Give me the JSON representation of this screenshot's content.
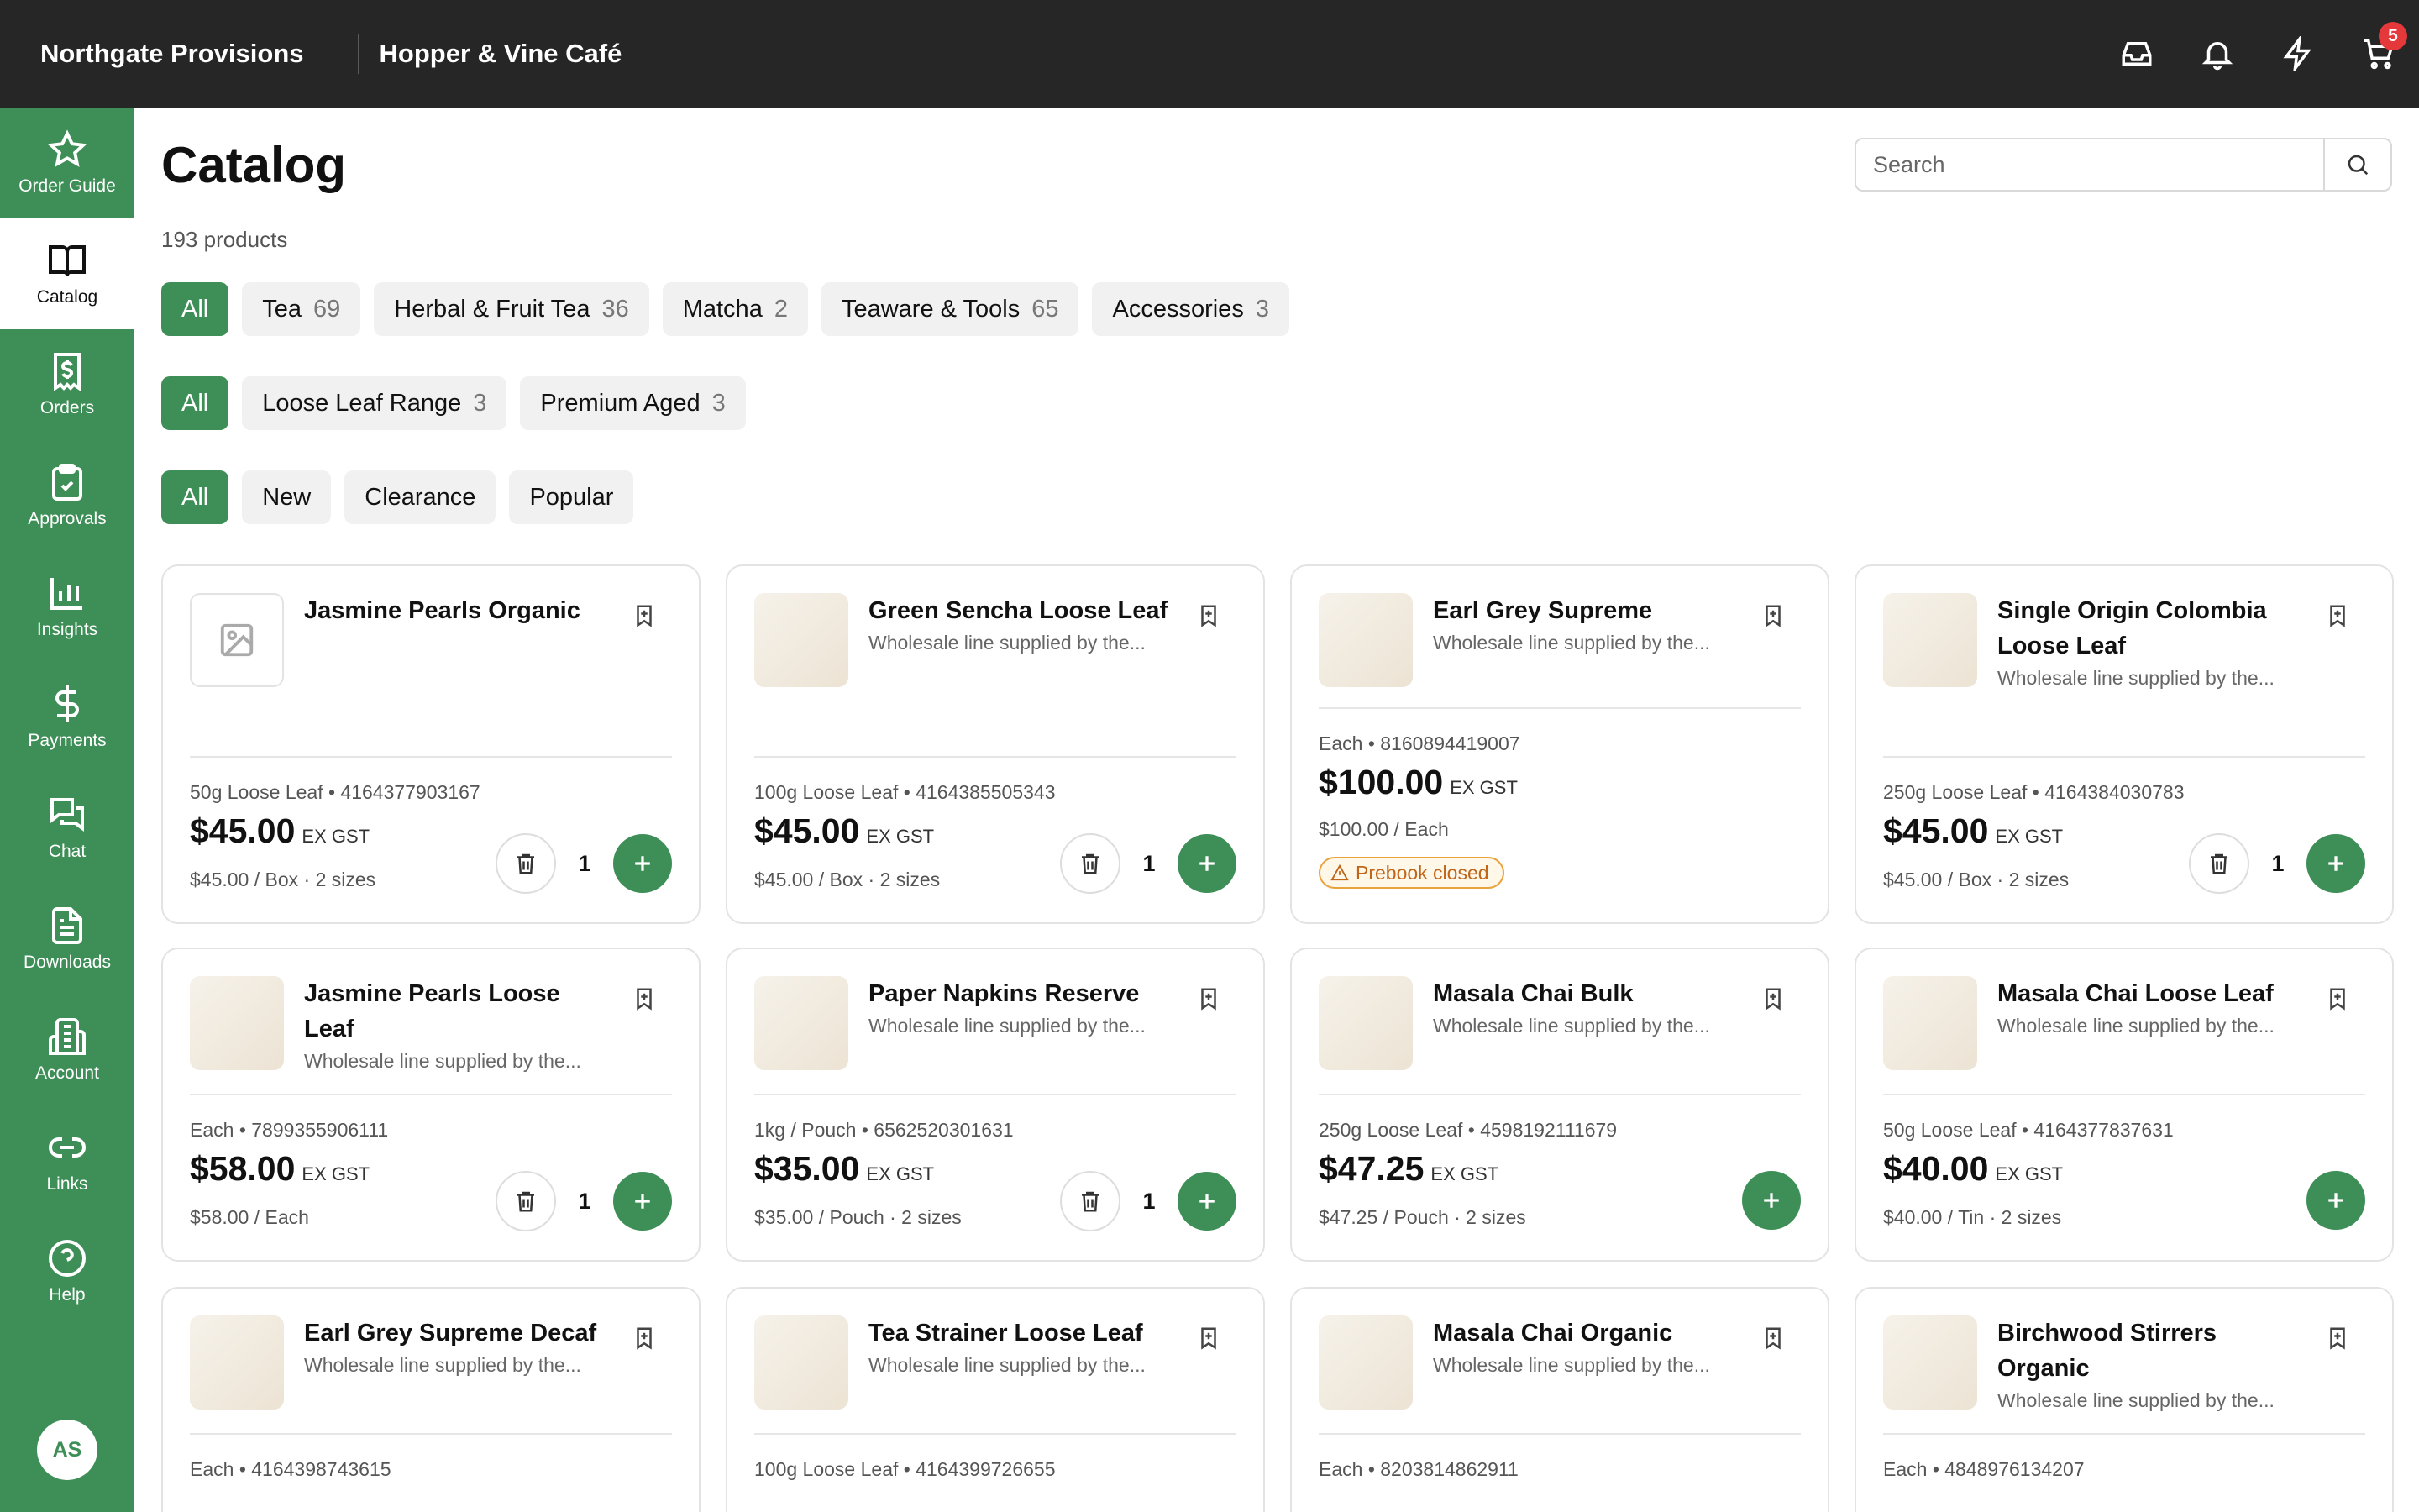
{
  "topbar": {
    "brand": "Northgate Provisions",
    "customer": "Hopper & Vine Café",
    "icons": [
      "inbox-icon",
      "bell-icon",
      "lightning-icon",
      "cart-icon"
    ],
    "cart_count": "5"
  },
  "sidebar": {
    "items": [
      {
        "label": "Order Guide",
        "icon": "star-icon"
      },
      {
        "label": "Catalog",
        "icon": "book-icon"
      },
      {
        "label": "Orders",
        "icon": "receipt-icon"
      },
      {
        "label": "Approvals",
        "icon": "clipboard-check-icon"
      },
      {
        "label": "Insights",
        "icon": "bar-chart-icon"
      },
      {
        "label": "Payments",
        "icon": "dollar-icon"
      },
      {
        "label": "Chat",
        "icon": "chat-icon"
      },
      {
        "label": "Downloads",
        "icon": "document-icon"
      },
      {
        "label": "Account",
        "icon": "building-icon"
      },
      {
        "label": "Links",
        "icon": "link-icon"
      },
      {
        "label": "Help",
        "icon": "help-icon"
      }
    ],
    "active": "Catalog",
    "avatar_initials": "AS"
  },
  "header": {
    "title": "Catalog",
    "product_count": "193 products",
    "search_placeholder": "Search"
  },
  "filters": {
    "categories": [
      {
        "label": "All",
        "count": ""
      },
      {
        "label": "Tea",
        "count": "69"
      },
      {
        "label": "Herbal & Fruit Tea",
        "count": "36"
      },
      {
        "label": "Matcha",
        "count": "2"
      },
      {
        "label": "Teaware & Tools",
        "count": "65"
      },
      {
        "label": "Accessories",
        "count": "3"
      }
    ],
    "ranges": [
      {
        "label": "All",
        "count": ""
      },
      {
        "label": "Loose Leaf Range",
        "count": "3"
      },
      {
        "label": "Premium Aged",
        "count": "3"
      }
    ],
    "tags": [
      {
        "label": "All",
        "count": ""
      },
      {
        "label": "New",
        "count": ""
      },
      {
        "label": "Clearance",
        "count": ""
      },
      {
        "label": "Popular",
        "count": ""
      }
    ]
  },
  "products": [
    {
      "name": "Jasmine Pearls Organic",
      "desc": "",
      "meta": "50g Loose Leaf • 4164377903167",
      "price": "$45.00",
      "gst": "EX GST",
      "unit": "$45.00 / Box · 2 sizes",
      "qty": "1",
      "warning": ""
    },
    {
      "name": "Green Sencha Loose Leaf",
      "desc": "Wholesale line supplied by the...",
      "meta": "100g Loose Leaf • 4164385505343",
      "price": "$45.00",
      "gst": "EX GST",
      "unit": "$45.00 / Box · 2 sizes",
      "qty": "1",
      "warning": ""
    },
    {
      "name": "Earl Grey Supreme",
      "desc": "Wholesale line supplied by the...",
      "meta": "Each • 8160894419007",
      "price": "$100.00",
      "gst": "EX GST",
      "unit": "$100.00 / Each",
      "qty": "",
      "warning": "Prebook closed"
    },
    {
      "name": "Single Origin Colombia Loose Leaf",
      "desc": "Wholesale line supplied by the...",
      "meta": "250g Loose Leaf • 4164384030783",
      "price": "$45.00",
      "gst": "EX GST",
      "unit": "$45.00 / Box · 2 sizes",
      "qty": "1",
      "warning": ""
    },
    {
      "name": "Jasmine Pearls Loose Leaf",
      "desc": "Wholesale line supplied by the...",
      "meta": "Each • 7899355906111",
      "price": "$58.00",
      "gst": "EX GST",
      "unit": "$58.00 / Each",
      "qty": "1",
      "warning": ""
    },
    {
      "name": "Paper Napkins Reserve",
      "desc": "Wholesale line supplied by the...",
      "meta": "1kg / Pouch • 6562520301631",
      "price": "$35.00",
      "gst": "EX GST",
      "unit": "$35.00 / Pouch · 2 sizes",
      "qty": "1",
      "warning": ""
    },
    {
      "name": "Masala Chai Bulk",
      "desc": "Wholesale line supplied by the...",
      "meta": "250g Loose Leaf • 4598192111679",
      "price": "$47.25",
      "gst": "EX GST",
      "unit": "$47.25 / Pouch · 2 sizes",
      "qty": "",
      "warning": ""
    },
    {
      "name": "Masala Chai Loose Leaf",
      "desc": "Wholesale line supplied by the...",
      "meta": "50g Loose Leaf • 4164377837631",
      "price": "$40.00",
      "gst": "EX GST",
      "unit": "$40.00 / Tin · 2 sizes",
      "qty": "",
      "warning": ""
    },
    {
      "name": "Earl Grey Supreme Decaf",
      "desc": "Wholesale line supplied by the...",
      "meta": "Each • 4164398743615",
      "price": "",
      "gst": "",
      "unit": "",
      "qty": "",
      "warning": ""
    },
    {
      "name": "Tea Strainer Loose Leaf",
      "desc": "Wholesale line supplied by the...",
      "meta": "100g Loose Leaf • 4164399726655",
      "price": "",
      "gst": "",
      "unit": "",
      "qty": "",
      "warning": ""
    },
    {
      "name": "Masala Chai Organic",
      "desc": "Wholesale line supplied by the...",
      "meta": "Each • 8203814862911",
      "price": "",
      "gst": "",
      "unit": "",
      "qty": "",
      "warning": ""
    },
    {
      "name": "Birchwood Stirrers Organic",
      "desc": "Wholesale line supplied by the...",
      "meta": "Each • 4848976134207",
      "price": "",
      "gst": "",
      "unit": "",
      "qty": "",
      "warning": ""
    }
  ]
}
